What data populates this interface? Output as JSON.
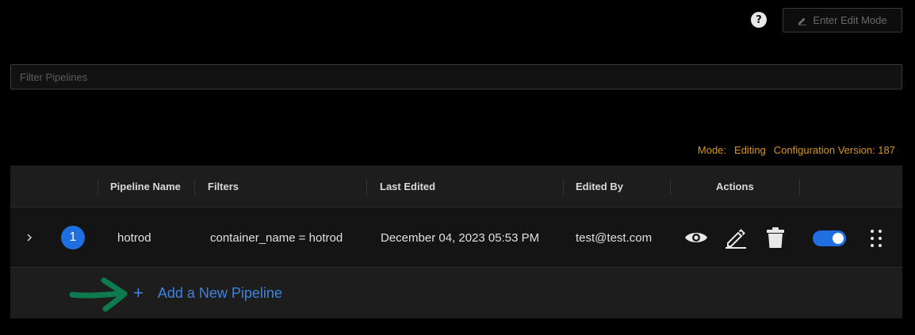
{
  "header": {
    "help_label": "?",
    "edit_mode_label": "Enter Edit Mode"
  },
  "filter": {
    "placeholder": "Filter Pipelines",
    "value": ""
  },
  "status": {
    "mode_label": "Mode:",
    "mode_value": "Editing",
    "config_version": "Configuration Version: 187"
  },
  "table": {
    "columns": {
      "name": "Pipeline Name",
      "filters": "Filters",
      "last_edited": "Last Edited",
      "edited_by": "Edited By",
      "actions": "Actions"
    },
    "rows": [
      {
        "order": "1",
        "name": "hotrod",
        "filters": "container_name = hotrod",
        "last_edited": "December 04, 2023 05:53 PM",
        "edited_by": "test@test.com",
        "enabled": true
      }
    ],
    "add_label": "Add a New Pipeline"
  },
  "icons": [
    "question-icon",
    "pencil-icon",
    "chevron-right-icon",
    "eye-icon",
    "edit-icon",
    "trash-icon",
    "more-vertical-icon",
    "plus-icon",
    "annotation-arrow"
  ],
  "colors": {
    "accent": "#1f6fe0",
    "link": "#3d83e0",
    "warning": "#d89614",
    "annotation": "#0e7a4f"
  }
}
